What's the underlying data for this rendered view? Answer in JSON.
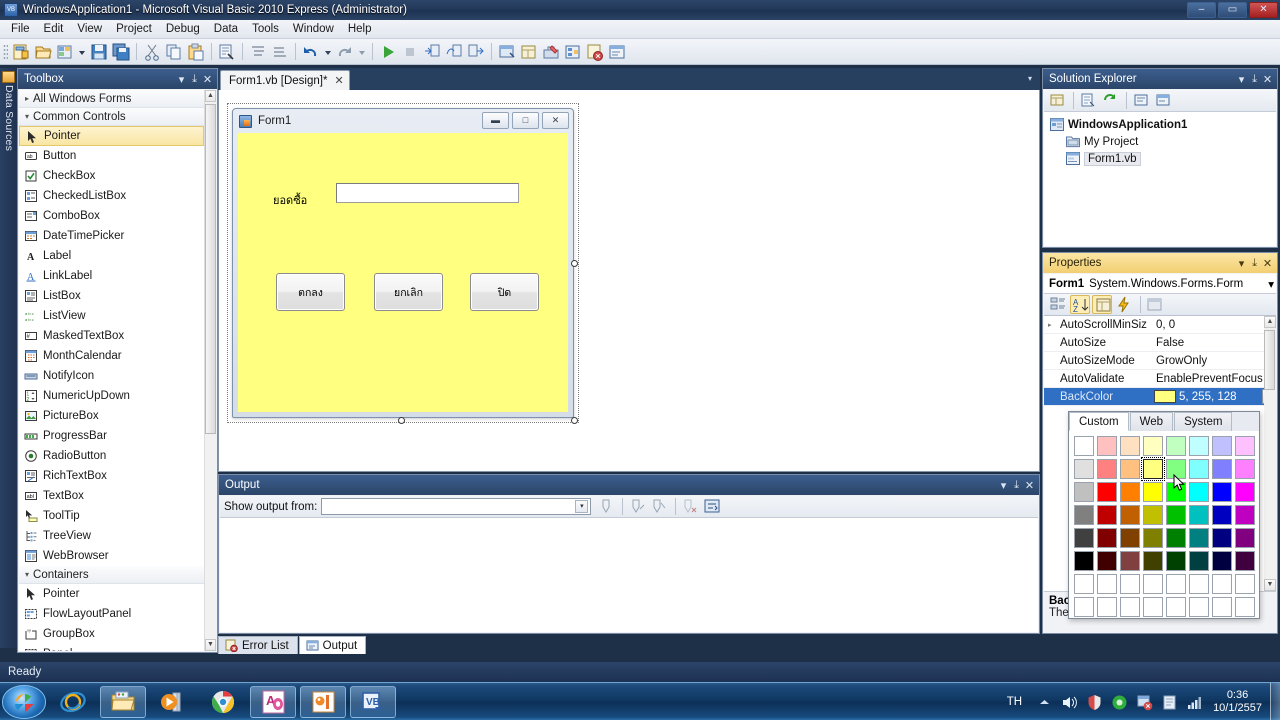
{
  "window": {
    "title": "WindowsApplication1 - Microsoft Visual Basic 2010 Express (Administrator)",
    "app_icon": "vb-app-icon",
    "minimize": "–",
    "maximize": "▭",
    "close": "✕"
  },
  "menubar": {
    "items": [
      "File",
      "Edit",
      "View",
      "Project",
      "Debug",
      "Data",
      "Tools",
      "Window",
      "Help"
    ]
  },
  "toolbar": {
    "icons": [
      "new-project-icon",
      "open-file-icon",
      "add-new-item-icon",
      "save-icon",
      "save-all-icon",
      "cut-icon",
      "copy-icon",
      "paste-icon",
      "find-icon",
      "comment-icon",
      "uncomment-icon",
      "undo-icon",
      "redo-icon",
      "start-debugging-icon",
      "stop-icon",
      "step-into-icon",
      "step-over-icon",
      "step-out-icon",
      "solution-explorer-icon",
      "properties-window-icon",
      "toolbox-icon",
      "object-browser-icon",
      "error-list-icon",
      "output-window-icon"
    ]
  },
  "data_sources_tab": {
    "label": "Data Sources",
    "icon": "data-sources-icon"
  },
  "toolbox": {
    "title": "Toolbox",
    "dropdown": "▾",
    "pin": "⤓",
    "close": "✕",
    "groups": [
      {
        "label": "All Windows Forms",
        "expanded": false,
        "tri": "▸",
        "items": []
      },
      {
        "label": "Common Controls",
        "expanded": true,
        "tri": "▾",
        "items": [
          {
            "label": "Pointer",
            "icon": "pointer-icon",
            "selected": true
          },
          {
            "label": "Button",
            "icon": "button-icon",
            "selected": false
          },
          {
            "label": "CheckBox",
            "icon": "checkbox-icon",
            "selected": false
          },
          {
            "label": "CheckedListBox",
            "icon": "checkedlistbox-icon",
            "selected": false
          },
          {
            "label": "ComboBox",
            "icon": "combobox-icon",
            "selected": false
          },
          {
            "label": "DateTimePicker",
            "icon": "datetimepicker-icon",
            "selected": false
          },
          {
            "label": "Label",
            "icon": "label-icon",
            "selected": false
          },
          {
            "label": "LinkLabel",
            "icon": "linklabel-icon",
            "selected": false
          },
          {
            "label": "ListBox",
            "icon": "listbox-icon",
            "selected": false
          },
          {
            "label": "ListView",
            "icon": "listview-icon",
            "selected": false
          },
          {
            "label": "MaskedTextBox",
            "icon": "maskedtextbox-icon",
            "selected": false
          },
          {
            "label": "MonthCalendar",
            "icon": "monthcalendar-icon",
            "selected": false
          },
          {
            "label": "NotifyIcon",
            "icon": "notifyicon-icon",
            "selected": false
          },
          {
            "label": "NumericUpDown",
            "icon": "numericupdown-icon",
            "selected": false
          },
          {
            "label": "PictureBox",
            "icon": "picturebox-icon",
            "selected": false
          },
          {
            "label": "ProgressBar",
            "icon": "progressbar-icon",
            "selected": false
          },
          {
            "label": "RadioButton",
            "icon": "radiobutton-icon",
            "selected": false
          },
          {
            "label": "RichTextBox",
            "icon": "richtextbox-icon",
            "selected": false
          },
          {
            "label": "TextBox",
            "icon": "textbox-icon",
            "selected": false
          },
          {
            "label": "ToolTip",
            "icon": "tooltip-icon",
            "selected": false
          },
          {
            "label": "TreeView",
            "icon": "treeview-icon",
            "selected": false
          },
          {
            "label": "WebBrowser",
            "icon": "webbrowser-icon",
            "selected": false
          }
        ]
      },
      {
        "label": "Containers",
        "expanded": true,
        "tri": "▾",
        "items": [
          {
            "label": "Pointer",
            "icon": "pointer-icon",
            "selected": false
          },
          {
            "label": "FlowLayoutPanel",
            "icon": "flowlayoutpanel-icon",
            "selected": false
          },
          {
            "label": "GroupBox",
            "icon": "groupbox-icon",
            "selected": false
          },
          {
            "label": "Panel",
            "icon": "panel-icon",
            "selected": false
          }
        ]
      }
    ]
  },
  "document_tab": {
    "label": "Form1.vb [Design]*",
    "close": "✕",
    "dropdown": "▾"
  },
  "designer": {
    "form": {
      "title": "Form1",
      "icon": "form-icon",
      "backcolor": "#ffff80",
      "minimize": "▬",
      "maximize": "□",
      "close": "✕",
      "label": {
        "text": "ยอดซื้อ"
      },
      "textbox": {
        "value": ""
      },
      "buttons": [
        {
          "text": "ตกลง"
        },
        {
          "text": "ยกเลิก"
        },
        {
          "text": "ปิด"
        }
      ]
    }
  },
  "output_panel": {
    "title": "Output",
    "dropdown": "▾",
    "pin": "⤓",
    "close": "✕",
    "show_output_from_label": "Show output from:",
    "combo_value": "",
    "combo_arrow": "▾",
    "buttons": [
      "find-message-icon",
      "go-to-previous-icon",
      "go-to-next-icon",
      "clear-all-icon",
      "toggle-word-wrap-icon"
    ],
    "body_text": ""
  },
  "dock_tabs": [
    {
      "label": "Error List",
      "icon": "error-list-icon",
      "active": false
    },
    {
      "label": "Output",
      "icon": "output-icon",
      "active": true
    }
  ],
  "solution_explorer": {
    "title": "Solution Explorer",
    "dropdown": "▾",
    "pin": "⤓",
    "close": "✕",
    "toolbar_icons": [
      "properties-icon",
      "show-all-files-icon",
      "refresh-icon",
      "view-code-icon",
      "view-designer-icon"
    ],
    "tree": [
      {
        "label": "WindowsApplication1",
        "icon": "project-icon",
        "level": 0,
        "bold": true,
        "selected": false
      },
      {
        "label": "My Project",
        "icon": "my-project-icon",
        "level": 1,
        "bold": false,
        "selected": false
      },
      {
        "label": "Form1.vb",
        "icon": "form-file-icon",
        "level": 1,
        "bold": false,
        "selected": true
      }
    ]
  },
  "properties": {
    "title": "Properties",
    "dropdown": "▾",
    "pin": "⤓",
    "close": "✕",
    "object_name": "Form1",
    "object_type": "System.Windows.Forms.Form",
    "object_dropdown": "▾",
    "toolbar_icons": [
      "categorized-icon",
      "alphabetical-icon",
      "properties-icon",
      "events-icon",
      "property-pages-icon"
    ],
    "rows": [
      {
        "key": "AutoScrollMinSiz",
        "value": "0, 0",
        "expander": "▸",
        "active": false
      },
      {
        "key": "AutoSize",
        "value": "False",
        "expander": "",
        "active": false
      },
      {
        "key": "AutoSizeMode",
        "value": "GrowOnly",
        "expander": "",
        "active": false
      },
      {
        "key": "AutoValidate",
        "value": "EnablePreventFocus",
        "expander": "",
        "active": false
      },
      {
        "key": "BackColor",
        "value": "5, 255, 128",
        "expander": "",
        "active": true,
        "swatch": "#ffff80",
        "dropdown": "▾"
      }
    ],
    "description": {
      "title": "BackColor",
      "text": "The background color of the component."
    }
  },
  "color_dropdown": {
    "tabs": [
      {
        "label": "Custom",
        "active": true
      },
      {
        "label": "Web",
        "active": false
      },
      {
        "label": "System",
        "active": false
      }
    ],
    "selected_index": 11,
    "swatches": [
      "#ffffff",
      "#ffc0c0",
      "#ffe0c0",
      "#ffffc0",
      "#c0ffc0",
      "#c0ffff",
      "#c0c0ff",
      "#ffc0ff",
      "#e0e0e0",
      "#ff8080",
      "#ffc080",
      "#ffff80",
      "#80ff80",
      "#80ffff",
      "#8080ff",
      "#ff80ff",
      "#c0c0c0",
      "#ff0000",
      "#ff8000",
      "#ffff00",
      "#00ff00",
      "#00ffff",
      "#0000ff",
      "#ff00ff",
      "#808080",
      "#c00000",
      "#c06000",
      "#c0c000",
      "#00c000",
      "#00c0c0",
      "#0000c0",
      "#c000c0",
      "#404040",
      "#800000",
      "#804000",
      "#808000",
      "#008000",
      "#008080",
      "#000080",
      "#800080",
      "#000000",
      "#400000",
      "#804040",
      "#404000",
      "#004000",
      "#004040",
      "#000040",
      "#400040",
      "#ffffff",
      "#ffffff",
      "#ffffff",
      "#ffffff",
      "#ffffff",
      "#ffffff",
      "#ffffff",
      "#ffffff",
      "#ffffff",
      "#ffffff",
      "#ffffff",
      "#ffffff",
      "#ffffff",
      "#ffffff",
      "#ffffff",
      "#ffffff"
    ]
  },
  "status_bar": {
    "text": "Ready"
  },
  "taskbar": {
    "start": "start-orb",
    "items": [
      {
        "name": "internet-explorer-icon",
        "pinned": false
      },
      {
        "name": "windows-explorer-icon",
        "pinned": true
      },
      {
        "name": "windows-media-player-icon",
        "pinned": false
      },
      {
        "name": "google-chrome-icon",
        "pinned": false
      },
      {
        "name": "microsoft-access-icon",
        "pinned": true
      },
      {
        "name": "picture-manager-icon",
        "pinned": true
      },
      {
        "name": "visual-basic-icon",
        "pinned": true
      }
    ],
    "tray": {
      "language": "TH",
      "show_hidden": "▲",
      "icons": [
        "volume-icon",
        "security-shield-icon",
        "update-icon",
        "flag-icon",
        "devices-icon",
        "network-icon"
      ],
      "time": "0:36",
      "date": "10/1/2557"
    }
  }
}
